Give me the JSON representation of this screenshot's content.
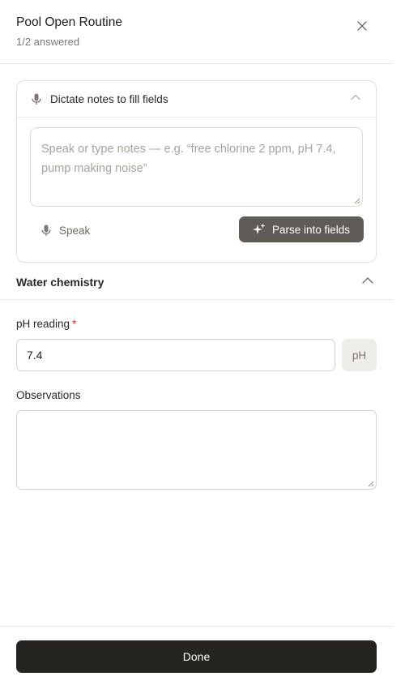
{
  "header": {
    "title": "Pool Open Routine",
    "subtitle": "1/2 answered",
    "close_icon": "close-icon"
  },
  "dictate": {
    "title": "Dictate notes to fill fields",
    "icon": "mic-icon",
    "collapse_icon": "chevron-up-icon",
    "notes_value": "",
    "notes_placeholder": "Speak or type notes — e.g. “free chlorine 2 ppm, pH 7.4, pump making noise”",
    "speak_label": "Speak",
    "speak_icon": "mic-icon",
    "parse_label": "Parse into fields",
    "parse_icon": "sparkle-icon",
    "parse_bg": "#5f5c58"
  },
  "section": {
    "title": "Water chemistry",
    "collapse_icon": "chevron-up-icon"
  },
  "fields": {
    "ph": {
      "label": "pH reading",
      "required_mark": "*",
      "value": "7.4",
      "unit": "pH"
    },
    "observations": {
      "label": "Observations",
      "value": ""
    }
  },
  "footer": {
    "done_label": "Done",
    "done_bg": "#262421"
  },
  "colors": {
    "required": "#d0342c",
    "text": "#1f1d1a",
    "muted": "#7d7872"
  }
}
